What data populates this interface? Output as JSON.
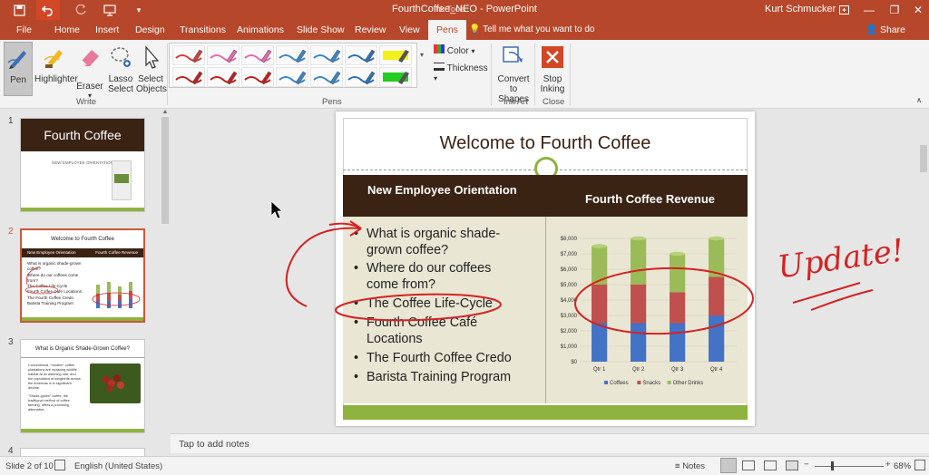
{
  "window": {
    "title": "FourthCoffee_NEO - PowerPoint",
    "context_tab_group": "Ink Tools",
    "user": "Kurt Schmucker"
  },
  "tabs": [
    "File",
    "Home",
    "Insert",
    "Design",
    "Transitions",
    "Animations",
    "Slide Show",
    "Review",
    "View",
    "Pens"
  ],
  "tell_me": "Tell me what you want to do",
  "share": "Share",
  "ribbon": {
    "write": {
      "pen": "Pen",
      "highlighter": "Highlighter",
      "eraser": "Eraser",
      "lasso": "Lasso Select",
      "select_objects": "Select Objects",
      "label": "Write"
    },
    "pens_label": "Pens",
    "color": "Color",
    "thickness": "Thickness",
    "ink_art": {
      "convert": "Convert to Shapes",
      "label": "Ink Art"
    },
    "close": {
      "stop": "Stop Inking",
      "label": "Close"
    }
  },
  "pen_colors": [
    "#d43c3c",
    "#e46ab0",
    "#e46ab0",
    "#3a86c8",
    "#3a86c8",
    "#2c6fb8",
    "#f2f21a",
    "#c11e1e",
    "#c11e1e",
    "#c11e1e",
    "#3a86c8",
    "#3a86c8",
    "#2c6fb8",
    "#22cc22"
  ],
  "thumbnails": [
    {
      "num": "1",
      "title": "Fourth Coffee",
      "sub": "NEW EMPLOYEE ORIENTATION"
    },
    {
      "num": "2",
      "title": "Welcome to Fourth Coffee",
      "left": "New Employee Orientation",
      "right": "Fourth Coffee Revenue",
      "bullets": [
        "What is organic shade-grown coffee?",
        "Where do our coffees come from?",
        "The Coffee Life-Cycle",
        "Fourth Coffee Café Locations",
        "The Fourth Coffee Credo",
        "Barista Training Program"
      ]
    },
    {
      "num": "3",
      "title": "What is Organic Shade-Grown Coffee?",
      "text1": "Conventional, \"modern\" coffee plantations are replacing wildlife habitat at an alarming rate, and the population of songbirds across the Americas is in significant decline.",
      "text2": "\"Shade-grown\" coffee, the traditional method of coffee farming, offers a promising alternative."
    },
    {
      "num": "4"
    }
  ],
  "slide": {
    "title": "Welcome to Fourth Coffee",
    "left_header": "New Employee Orientation",
    "right_header": "Fourth Coffee Revenue",
    "bullets": [
      "What is organic shade-grown coffee?",
      "Where do our coffees come from?",
      "The Coffee Life-Cycle",
      "Fourth Coffee Café Locations",
      "The Fourth Coffee Credo",
      "Barista Training Program"
    ],
    "ink_note": "Update!"
  },
  "chart_data": {
    "type": "bar",
    "stacked": true,
    "categories": [
      "Qtr 1",
      "Qtr 2",
      "Qtr 3",
      "Qtr 4"
    ],
    "series": [
      {
        "name": "Coffees",
        "color": "#4472c4",
        "values": [
          2500,
          2500,
          2500,
          3000
        ]
      },
      {
        "name": "Snacks",
        "color": "#c0504d",
        "values": [
          2500,
          2500,
          2000,
          2500
        ]
      },
      {
        "name": "Other Drinks",
        "color": "#9bbb59",
        "values": [
          2500,
          3000,
          2500,
          2500
        ]
      }
    ],
    "y_ticks": [
      "$0",
      "$1,000",
      "$2,000",
      "$3,000",
      "$4,000",
      "$5,000",
      "$6,000",
      "$7,000",
      "$8,000"
    ],
    "ylim": [
      0,
      8000
    ],
    "grid": true,
    "legend": "bottom"
  },
  "notes_placeholder": "Tap to add notes",
  "status": {
    "slide": "Slide 2 of 10",
    "language": "English (United States)",
    "notes": "Notes",
    "zoom": "68%"
  }
}
